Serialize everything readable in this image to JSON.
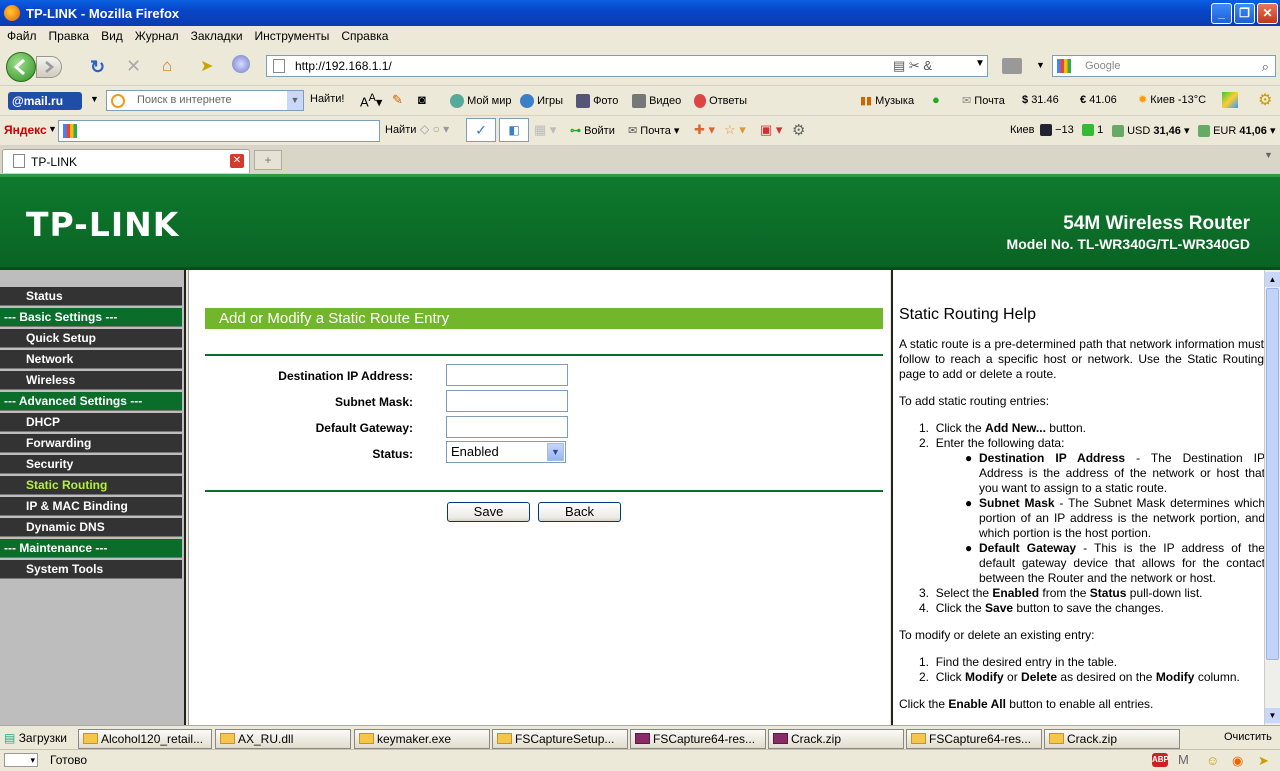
{
  "window": {
    "title": "TP-LINK - Mozilla Firefox"
  },
  "menu": [
    "Файл",
    "Правка",
    "Вид",
    "Журнал",
    "Закладки",
    "Инструменты",
    "Справка"
  ],
  "nav": {
    "url": "http://192.168.1.1/",
    "search_placeholder": "Google"
  },
  "mailbar": {
    "logo": "@mail.ru",
    "search_placeholder": "Поиск в интернете",
    "find": "Найти!",
    "links": [
      "Мой мир",
      "Игры",
      "Фото",
      "Видео",
      "Ответы"
    ],
    "music": "Музыка",
    "mail": "Почта",
    "usd": "31.46",
    "eur": "41.06",
    "weather": "Киев -13°C"
  },
  "yandexbar": {
    "logo": "Яндекс",
    "find": "Найти",
    "login": "Войти",
    "mail": "Почта",
    "city": "Киев",
    "temp": "−13",
    "count": "1",
    "usd_label": "USD",
    "usd": "31,46",
    "eur_label": "EUR",
    "eur": "41,06"
  },
  "tab": {
    "label": "TP-LINK"
  },
  "router": {
    "logo": "TP-LINK",
    "product": "54M Wireless Router",
    "model": "Model No. TL-WR340G/TL-WR340GD"
  },
  "sidebar": [
    {
      "label": "Status",
      "type": "item"
    },
    {
      "label": "--- Basic Settings ---",
      "type": "section"
    },
    {
      "label": "Quick Setup",
      "type": "item"
    },
    {
      "label": "Network",
      "type": "item"
    },
    {
      "label": "Wireless",
      "type": "item"
    },
    {
      "label": "--- Advanced Settings ---",
      "type": "section"
    },
    {
      "label": "DHCP",
      "type": "item"
    },
    {
      "label": "Forwarding",
      "type": "item"
    },
    {
      "label": "Security",
      "type": "item"
    },
    {
      "label": "Static Routing",
      "type": "active"
    },
    {
      "label": "IP & MAC Binding",
      "type": "item"
    },
    {
      "label": "Dynamic DNS",
      "type": "item"
    },
    {
      "label": "--- Maintenance ---",
      "type": "section"
    },
    {
      "label": "System Tools",
      "type": "item"
    }
  ],
  "form": {
    "title": "Add or Modify a Static Route Entry",
    "dest_label": "Destination IP Address:",
    "mask_label": "Subnet Mask:",
    "gw_label": "Default Gateway:",
    "status_label": "Status:",
    "status_value": "Enabled",
    "save": "Save",
    "back": "Back"
  },
  "help": {
    "title": "Static Routing Help",
    "intro": "A static route is a pre-determined path that network information must follow to reach a specific host or network. Use the Static Routing page to add or delete a route.",
    "add_heading": "To add static routing entries:",
    "step1a": "Click the ",
    "step1b": "Add New...",
    "step1c": " button.",
    "step2": "Enter the following data:",
    "b1_title": "Destination IP Address",
    "b1_text": " - The Destination IP Address is the address of the network or host that you want to assign to a static route.",
    "b2_title": "Subnet Mask",
    "b2_text": " - The Subnet Mask determines which portion of an IP address is the network portion, and which portion is the host portion.",
    "b3_title": "Default Gateway",
    "b3_text": " - This is the IP address of the default gateway device that allows for the contact between the Router and the network or host.",
    "step3a": "Select the ",
    "step3b": "Enabled",
    "step3c": " from the ",
    "step3d": "Status",
    "step3e": " pull-down list.",
    "step4a": "Click the ",
    "step4b": "Save",
    "step4c": " button to save the changes.",
    "mod_heading": "To modify or delete an existing entry:",
    "m1": "Find the desired entry in the table.",
    "m2a": "Click ",
    "m2b": "Modify",
    "m2c": " or ",
    "m2d": "Delete",
    "m2e": " as desired on the ",
    "m2f": "Modify",
    "m2g": " column.",
    "last_a": "Click the ",
    "last_b": "Enable All",
    "last_c": " button to enable all entries."
  },
  "taskbar": {
    "downloads": "Загрузки",
    "tasks": [
      "Alcohol120_retail...",
      "AX_RU.dll",
      "keymaker.exe",
      "FSCaptureSetup...",
      "FSCapture64-res...",
      "Crack.zip",
      "FSCapture64-res...",
      "Crack.zip"
    ],
    "clear": "Очистить"
  },
  "status": {
    "text": "Готово"
  }
}
